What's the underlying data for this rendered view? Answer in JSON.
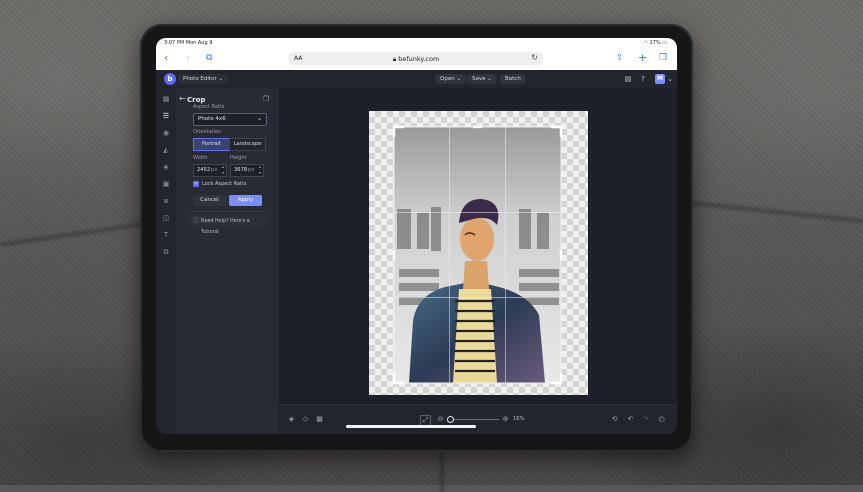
{
  "status_bar": {
    "time": "3:07 PM  Mon Aug 9",
    "battery": "17%"
  },
  "browser": {
    "url": "befunky.com",
    "text_size_label": "AA"
  },
  "app": {
    "mode_label": "Photo Editor",
    "menu": {
      "open": "Open",
      "save": "Save",
      "batch": "Batch"
    },
    "avatar_initial": "M",
    "accent_color": "#7b8cff"
  },
  "crop_panel": {
    "title": "Crop",
    "aspect_ratio_label": "Aspect Ratio",
    "aspect_ratio_value": "Photo 4x6",
    "orientation_label": "Orientation",
    "orientation_options": [
      "Portrait",
      "Landscape"
    ],
    "orientation_selected": "Portrait",
    "width_label": "Width",
    "height_label": "Height",
    "width_value": "2452",
    "height_value": "3678",
    "unit": "px",
    "lock_label": "Lock Aspect Ratio",
    "lock_checked": true,
    "cancel_label": "Cancel",
    "apply_label": "Apply",
    "help_text": "Need Help? Here's a Tutorial"
  },
  "canvas": {
    "zoom": "16%"
  }
}
